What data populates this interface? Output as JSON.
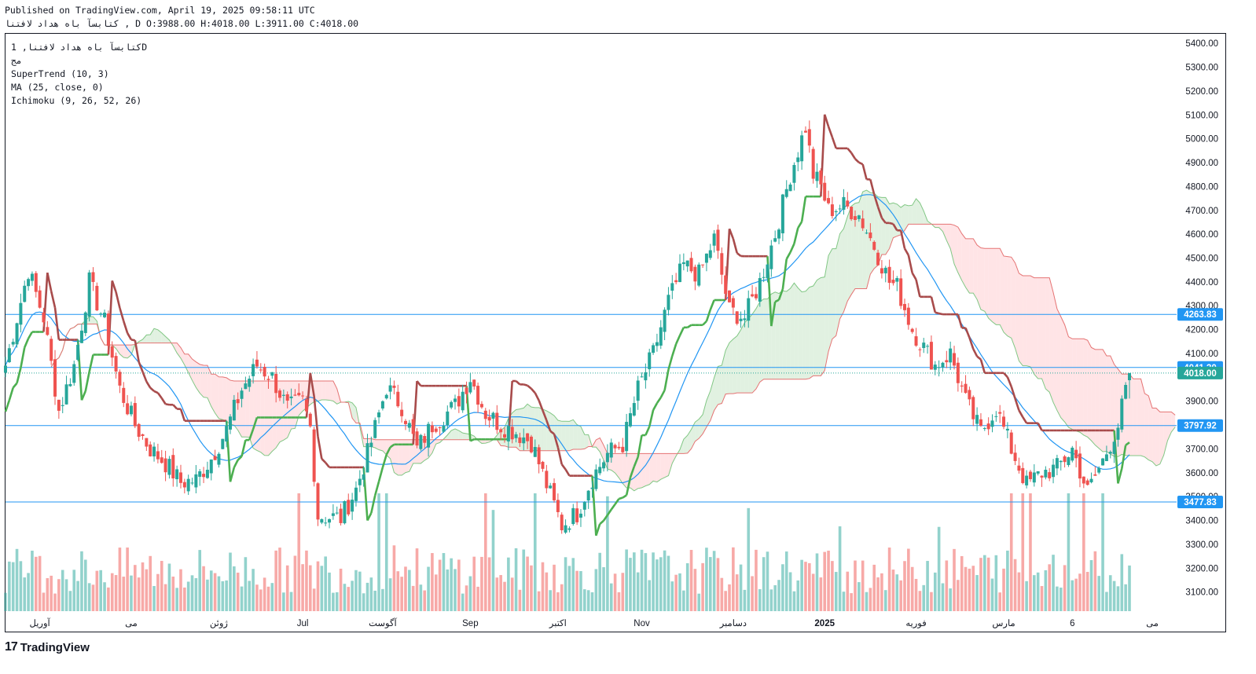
{
  "header": {
    "published": "Published on TradingView.com, April 19, 2025 09:58:11 UTC",
    "ohlc": "کتابسآ باه هداد لافتنا , D O:3988.00 H:4018.00 L:3911.00 C:4018.00"
  },
  "legend": {
    "symbol": "کتابسآ باه هداد لافتنا, 1D",
    "exchange": "مج",
    "supertrend": "SuperTrend (10, 3)",
    "ma": "MA (25, close, 0)",
    "ichimoku": "Ichimoku (9, 26, 52, 26)"
  },
  "footer": {
    "brand": "TradingView"
  },
  "colors": {
    "up": "#26a69a",
    "down": "#ef5350",
    "supertrend_up": "#4caf50",
    "supertrend_down": "#a84b4b",
    "ma": "#2196f3",
    "cloud_up": "#c8e6c9",
    "cloud_down": "#ffcdd2",
    "hline": "#2196f3"
  },
  "chart_data": {
    "type": "candlestick",
    "title": "",
    "y_axis": {
      "ticks": [
        5400,
        5300,
        5200,
        5100,
        5000,
        4900,
        4800,
        4700,
        4600,
        4500,
        4400,
        4300,
        4200,
        4100,
        3900,
        3800,
        3700,
        3600,
        3500,
        3400,
        3300,
        3200,
        3100
      ],
      "range": [
        3020,
        5440
      ]
    },
    "x_axis": {
      "labels": [
        "آوریل",
        "می",
        "ژوئن",
        "Jul",
        "آگوست",
        "Sep",
        "اکتبر",
        "Nov",
        "دسامبر",
        "2025",
        "فوریه",
        "مارس",
        "6",
        "می"
      ]
    },
    "price_labels": [
      {
        "value": 4263.83,
        "text": "4263.83"
      },
      {
        "value": 4041.3,
        "text": "4041.30"
      },
      {
        "value": 4018.0,
        "text": "4018.00"
      },
      {
        "value": 3797.92,
        "text": "3797.92"
      },
      {
        "value": 3477.83,
        "text": "3477.83"
      }
    ],
    "horizontal_lines": [
      4263.83,
      4041.3,
      3797.92,
      3477.83
    ],
    "close_anchors": [
      [
        0,
        4050
      ],
      [
        6,
        4450
      ],
      [
        10,
        4250
      ],
      [
        14,
        3860
      ],
      [
        18,
        4050
      ],
      [
        22,
        4400
      ],
      [
        26,
        4230
      ],
      [
        30,
        3950
      ],
      [
        34,
        3800
      ],
      [
        38,
        3700
      ],
      [
        42,
        3640
      ],
      [
        46,
        3560
      ],
      [
        50,
        3570
      ],
      [
        54,
        3660
      ],
      [
        58,
        3780
      ],
      [
        62,
        3950
      ],
      [
        66,
        4050
      ],
      [
        70,
        4000
      ],
      [
        74,
        3870
      ],
      [
        78,
        3900
      ],
      [
        80,
        3790
      ],
      [
        82,
        3420
      ],
      [
        88,
        3410
      ],
      [
        92,
        3530
      ],
      [
        96,
        3730
      ],
      [
        100,
        3960
      ],
      [
        104,
        3880
      ],
      [
        108,
        3700
      ],
      [
        112,
        3800
      ],
      [
        118,
        3880
      ],
      [
        122,
        4000
      ],
      [
        126,
        3850
      ],
      [
        130,
        3800
      ],
      [
        134,
        3770
      ],
      [
        138,
        3730
      ],
      [
        142,
        3550
      ],
      [
        146,
        3380
      ],
      [
        150,
        3430
      ],
      [
        154,
        3580
      ],
      [
        158,
        3680
      ],
      [
        162,
        3720
      ],
      [
        166,
        3950
      ],
      [
        170,
        4100
      ],
      [
        174,
        4320
      ],
      [
        178,
        4470
      ],
      [
        182,
        4430
      ],
      [
        186,
        4580
      ],
      [
        190,
        4280
      ],
      [
        194,
        4250
      ],
      [
        198,
        4400
      ],
      [
        202,
        4600
      ],
      [
        206,
        4850
      ],
      [
        210,
        5050
      ],
      [
        212,
        4850
      ],
      [
        214,
        4800
      ],
      [
        216,
        4700
      ],
      [
        220,
        4720
      ],
      [
        224,
        4680
      ],
      [
        228,
        4550
      ],
      [
        232,
        4400
      ],
      [
        234,
        4380
      ],
      [
        238,
        4200
      ],
      [
        244,
        4050
      ],
      [
        248,
        4100
      ],
      [
        252,
        3900
      ],
      [
        256,
        3770
      ],
      [
        260,
        3870
      ],
      [
        264,
        3700
      ],
      [
        268,
        3550
      ],
      [
        272,
        3600
      ],
      [
        276,
        3620
      ],
      [
        280,
        3700
      ],
      [
        284,
        3520
      ],
      [
        288,
        3650
      ],
      [
        292,
        3800
      ],
      [
        295,
        4018
      ]
    ],
    "volume_range": [
      0,
      7000000
    ],
    "last": {
      "open": 3988.0,
      "high": 4018.0,
      "low": 3911.0,
      "close": 4018.0
    }
  }
}
